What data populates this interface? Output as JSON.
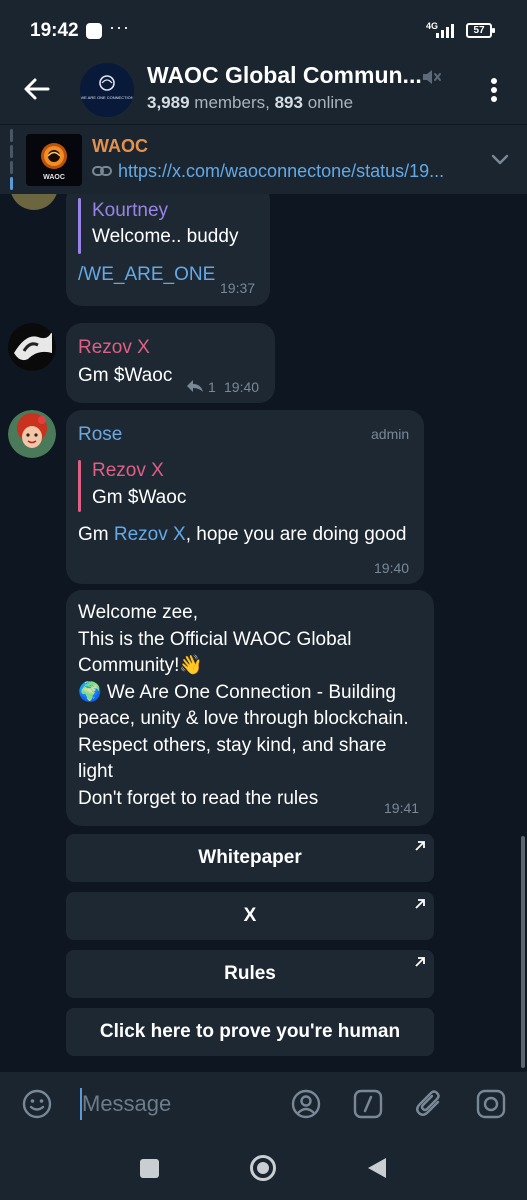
{
  "status": {
    "time": "19:42",
    "dots": "···",
    "network": "4G",
    "battery": "57"
  },
  "header": {
    "title": "WAOC Global Commun...",
    "members_count": "3,989",
    "members_word": "members,",
    "online_count": "893",
    "online_word": "online",
    "avatar_text": "WE ARE ONE CONNECTION"
  },
  "pinned": {
    "title": "WAOC",
    "link": "https://x.com/waoconnectone/status/19...",
    "thumb_text": "WAOC"
  },
  "messages": {
    "m1": {
      "reply_name": "Kourtney",
      "reply_text": "Welcome.. buddy",
      "text": "/WE_ARE_ONE",
      "time": "19:37"
    },
    "m2": {
      "sender": "Rezov X",
      "text": "Gm $Waoc",
      "replies": "1",
      "time": "19:40"
    },
    "m3": {
      "sender": "Rose",
      "badge": "admin",
      "reply_name": "Rezov X",
      "reply_text": "Gm $Waoc",
      "text_prefix": "Gm ",
      "mention": "Rezov X",
      "text_suffix": ", hope you are doing good",
      "time": "19:40"
    },
    "m4": {
      "lines": [
        "Welcome zee,",
        "This is the Official WAOC Global",
        "Community!👋",
        "🌍 We Are One Connection - Building",
        "peace, unity & love through blockchain.",
        "Respect others, stay kind, and share",
        "light",
        "Don't forget to read the rules"
      ],
      "time": "19:41"
    }
  },
  "keyboard_buttons": [
    "Whitepaper",
    "X",
    "Rules",
    "Click here to prove you're human"
  ],
  "input": {
    "placeholder": "Message"
  },
  "colors": {
    "background": "#0e1621",
    "bar": "#1a2530",
    "bubble": "#1e2833",
    "link": "#64a9e6",
    "kourtney": "#9a83e6",
    "rezov": "#e05f85",
    "rose": "#6aa8e0",
    "pinned_title": "#e4914d"
  },
  "icons": {
    "back": "arrow-left-icon",
    "mute": "mute-icon",
    "menu": "more-vertical-icon",
    "link": "link-icon",
    "chevron": "chevron-down-icon",
    "reply": "reply-icon",
    "external": "external-arrow-icon",
    "emoji": "emoji-icon",
    "mention": "mention-icon",
    "commands": "commands-icon",
    "attach": "paperclip-icon",
    "camera": "camera-icon"
  }
}
